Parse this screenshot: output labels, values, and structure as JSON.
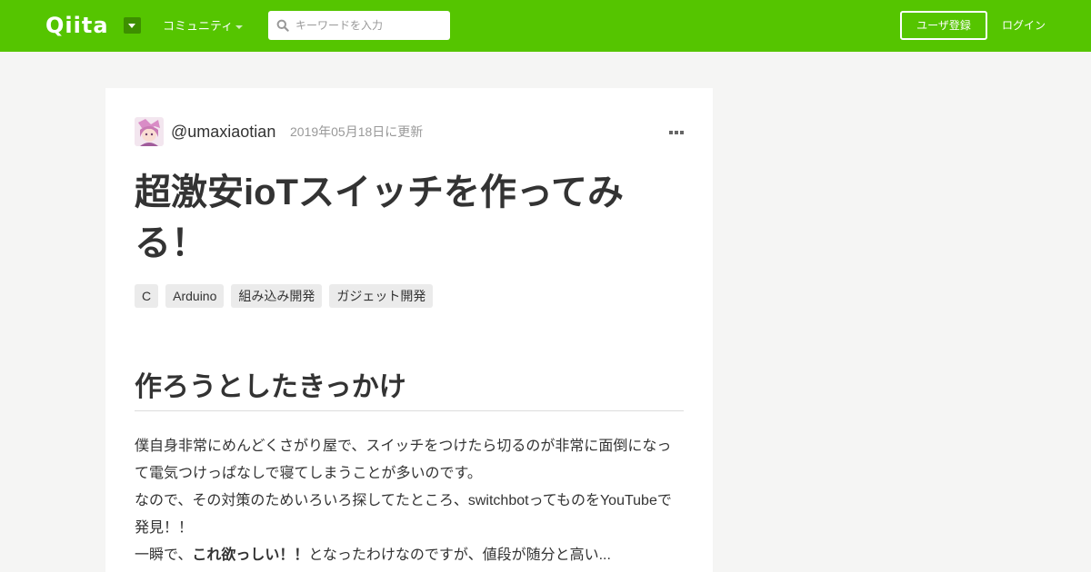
{
  "header": {
    "logo_text": "Qiita",
    "community_label": "コミュニティ",
    "search": {
      "placeholder": "キーワードを入力",
      "value": ""
    },
    "signup_label": "ユーザ登録",
    "login_label": "ログイン",
    "colors": {
      "brand": "#55c500",
      "brand_dark": "#3d8f00"
    }
  },
  "article": {
    "author": {
      "handle": "@umaxiaotian",
      "avatar_icon": "avatar-image"
    },
    "updated_at": "2019年05月18日に更新",
    "menu_icon": "more-dots-icon",
    "title": "超激安ioTスイッチを作ってみる！",
    "tags": [
      "C",
      "Arduino",
      "組み込み開発",
      "ガジェット開発"
    ],
    "section_heading": "作ろうとしたきっかけ",
    "paragraphs": {
      "p1": "僕自身非常にめんどくさがり屋で、スイッチをつけたら切るのが非常に面倒になって電気つけっぱなしで寝てしまうことが多いのです。",
      "p2": "なので、その対策のためいろいろ探してたところ、switchbotってものをYouTubeで発見！！",
      "p3_pre": "一瞬で、",
      "p3_strong": "これ欲っしい！！",
      "p3_post": "となったわけなのですが、値段が随分と高い..."
    }
  }
}
